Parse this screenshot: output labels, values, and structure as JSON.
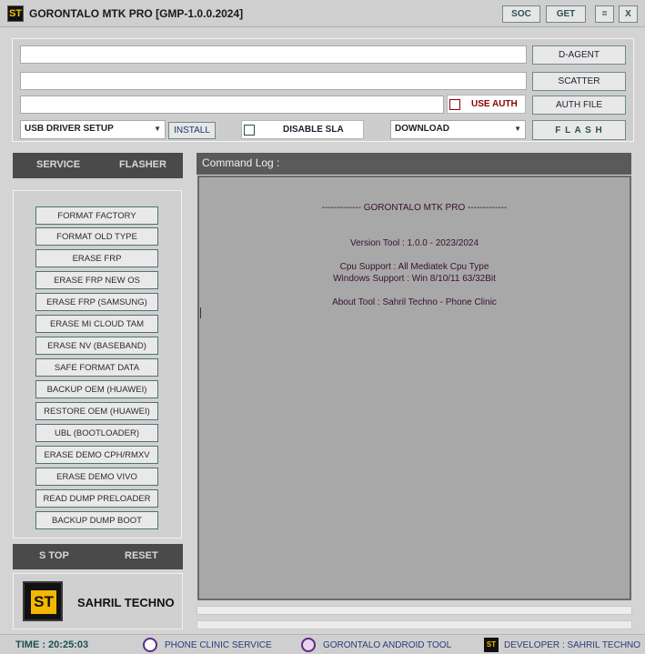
{
  "titlebar": {
    "app_icon": "ST",
    "title": "GORONTALO MTK PRO  [GMP-1.0.0.2024]",
    "soc": "SOC",
    "get": "GET",
    "menu": "=",
    "close": "X"
  },
  "files": {
    "da_path": "",
    "scatter_path": "",
    "auth_path": "",
    "d_agent": "D-AGENT",
    "scatter": "SCATTER",
    "auth_file": "AUTH FILE",
    "use_auth": "USE AUTH"
  },
  "controls": {
    "driver_select": "USB DRIVER SETUP",
    "install": "INSTALL",
    "disable_sla": "DISABLE SLA",
    "mode_select": "DOWNLOAD",
    "flash": "F L A S H"
  },
  "tabs": {
    "service": "SERVICE",
    "flasher": "FLASHER"
  },
  "tools": [
    "FORMAT FACTORY",
    "FORMAT OLD TYPE",
    "ERASE FRP",
    "ERASE FRP NEW OS",
    "ERASE FRP (SAMSUNG)",
    "ERASE MI CLOUD TAM",
    "ERASE NV (BASEBAND)",
    "SAFE FORMAT DATA",
    "BACKUP OEM (HUAWEI)",
    "RESTORE OEM (HUAWEI)",
    "UBL (BOOTLOADER)",
    "ERASE DEMO CPH/RMXV",
    "ERASE DEMO VIVO",
    "READ DUMP PRELOADER",
    "BACKUP DUMP BOOT"
  ],
  "actions": {
    "stop": "S TOP",
    "reset": "RESET"
  },
  "brand": {
    "logo": "ST",
    "name": "SAHRIL TECHNO"
  },
  "log": {
    "title": "Command Log :",
    "lines": [
      "------------- GORONTALO MTK PRO -------------",
      "Version Tool :  1.0.0 - 2023/2024",
      "Cpu Support :  All Mediatek Cpu Type",
      "Windows Support :  Win 8/10/11 63/32Bit",
      "About Tool :  Sahril Techno - Phone Clinic"
    ]
  },
  "status": {
    "time": "TIME :  20:25:03",
    "phone_clinic": "PHONE CLINIC SERVICE",
    "android_tool": "GORONTALO ANDROID TOOL",
    "developer": "DEVELOPER :  SAHRIL TECHNO",
    "dev_icon": "ST"
  },
  "colors": {
    "accent_text": "#2b5050",
    "use_auth_text": "#8b0000",
    "log_text": "#3a1030",
    "status_text": "#2e3a7a",
    "time_text": "#1a5050",
    "logo_yellow": "#f2b800"
  }
}
